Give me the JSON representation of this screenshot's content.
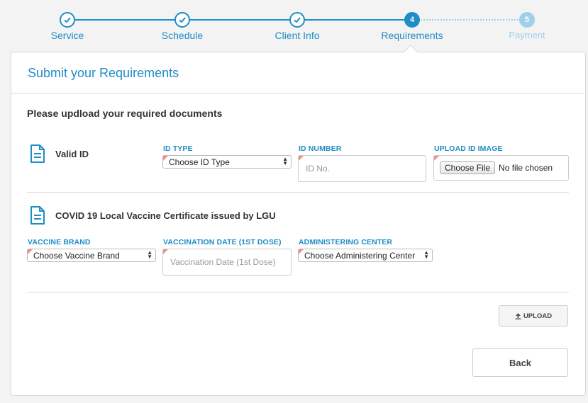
{
  "stepper": {
    "steps": [
      {
        "label": "Service",
        "state": "done"
      },
      {
        "label": "Schedule",
        "state": "done"
      },
      {
        "label": "Client Info",
        "state": "done"
      },
      {
        "label": "Requirements",
        "number": "4",
        "state": "active"
      },
      {
        "label": "Payment",
        "number": "5",
        "state": "pending"
      }
    ]
  },
  "card": {
    "title": "Submit your Requirements",
    "subheading": "Please updload your required documents"
  },
  "valid_id": {
    "title": "Valid ID",
    "id_type_label": "ID TYPE",
    "id_type_value": "Choose ID Type",
    "id_number_label": "ID NUMBER",
    "id_number_placeholder": "ID No.",
    "upload_label": "UPLOAD ID IMAGE",
    "choose_file": "Choose File",
    "no_file": "No file chosen"
  },
  "vaccine": {
    "title": "COVID 19 Local Vaccine Certificate issued by LGU",
    "brand_label": "VACCINE BRAND",
    "brand_value": "Choose Vaccine Brand",
    "date_label": "VACCINATION DATE (1ST DOSE)",
    "date_placeholder": "Vaccination Date (1st Dose)",
    "center_label": "ADMINISTERING CENTER",
    "center_value": "Choose Administering Center"
  },
  "actions": {
    "upload": "UPLOAD",
    "back": "Back"
  },
  "colors": {
    "accent": "#1f8dc6",
    "pending": "#9fd0ea",
    "required_flag": "#ef8f8f"
  }
}
